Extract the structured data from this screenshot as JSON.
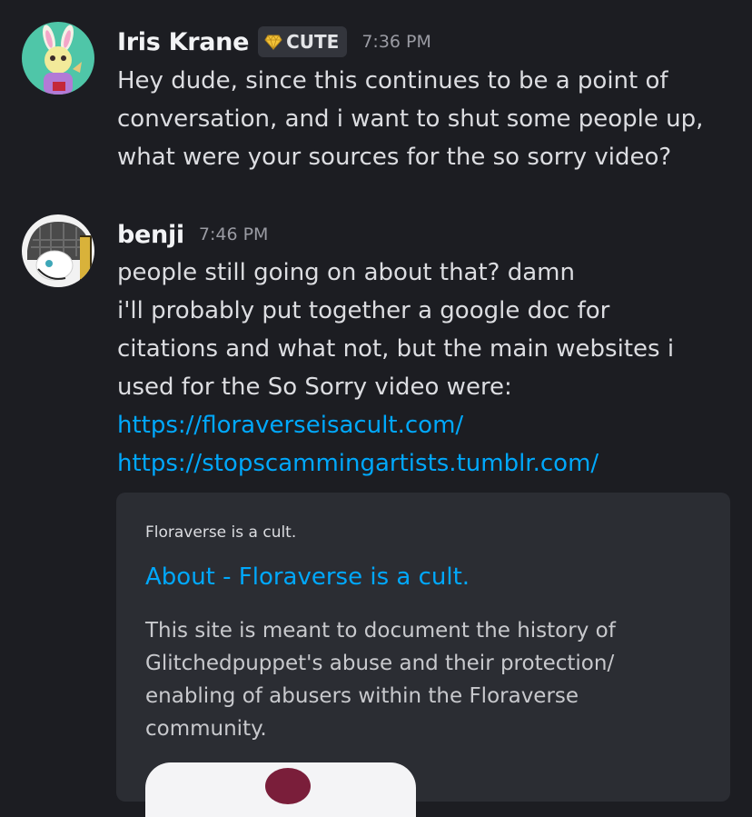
{
  "messages": [
    {
      "username": "Iris Krane",
      "badge": "CUTE",
      "time": "7:36 PM",
      "lines": [
        "Hey dude, since this continues to be a point of",
        "conversation, and i want to shut some people up,",
        "what were your sources for the so sorry video?"
      ]
    },
    {
      "username": "benji",
      "time": "7:46 PM",
      "lines": [
        "people still going on about that? damn",
        "i'll probably put together a google doc for",
        "citations and what not, but the main websites i",
        "used for the So Sorry video were:"
      ],
      "links": [
        "https://floraverseisacult.com/",
        "https://stopscammingartists.tumblr.com/"
      ]
    }
  ],
  "embed": {
    "provider": "Floraverse is a cult.",
    "title": "About - Floraverse is a cult.",
    "description_lines": [
      "This site is meant to document the history of",
      "Glitchedpuppet's abuse and their protection/",
      "enabling of abusers within the Floraverse",
      "community."
    ]
  },
  "colors": {
    "background": "#1c1d22",
    "link": "#00a8fc",
    "embed_bg": "#2b2d33"
  },
  "icons": {
    "badge": "gold-heart-gem-icon"
  }
}
